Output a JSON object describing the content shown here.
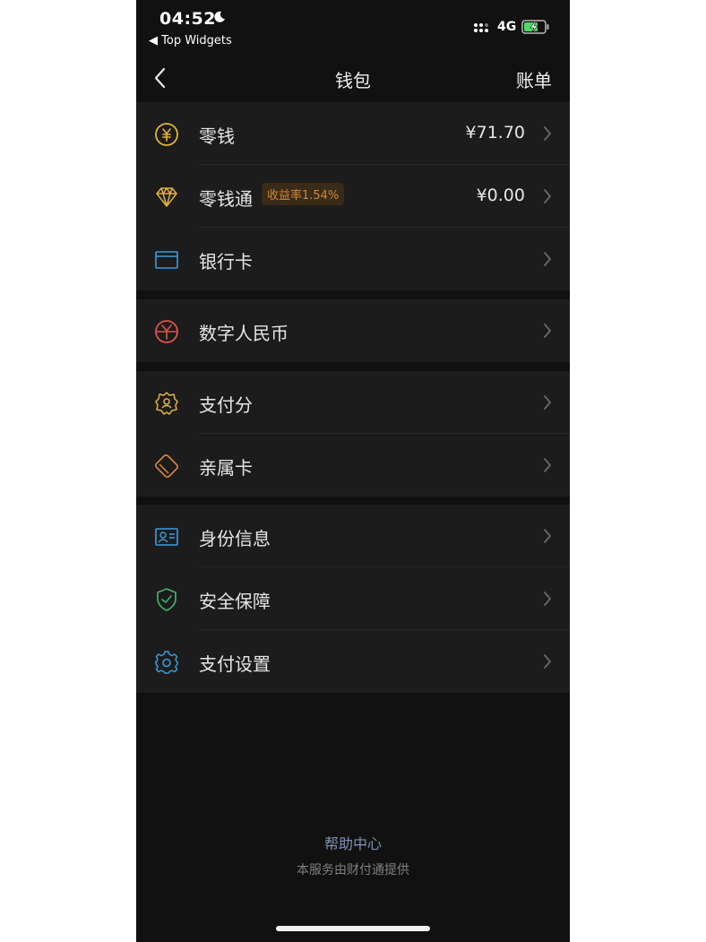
{
  "status_bar": {
    "time": "04:52",
    "back_app": "◀ Top Widgets",
    "network": "4G"
  },
  "nav": {
    "title": "钱包",
    "right": "账单"
  },
  "items": {
    "change": {
      "label": "零钱",
      "value": "¥71.70",
      "icon": "yuan-coin-icon",
      "color": "#e4b43a"
    },
    "licaitong": {
      "label": "零钱通",
      "badge": "收益率1.54%",
      "value": "¥0.00",
      "icon": "diamond-icon",
      "color": "#e4b43a"
    },
    "bank_card": {
      "label": "银行卡",
      "icon": "card-icon",
      "color": "#3a9be0"
    },
    "digital_rmb": {
      "label": "数字人民币",
      "icon": "digital-rmb-icon",
      "color": "#e0534a"
    },
    "pay_score": {
      "label": "支付分",
      "icon": "badge-person-icon",
      "color": "#e4b43a"
    },
    "family_card": {
      "label": "亲属卡",
      "icon": "family-card-icon",
      "color": "#e08a3a"
    },
    "identity": {
      "label": "身份信息",
      "icon": "id-card-icon",
      "color": "#3a9be0"
    },
    "security": {
      "label": "安全保障",
      "icon": "shield-icon",
      "color": "#3fb36a"
    },
    "pay_settings": {
      "label": "支付设置",
      "icon": "gear-icon",
      "color": "#3a9be0"
    }
  },
  "footer": {
    "help": "帮助中心",
    "note": "本服务由财付通提供"
  }
}
